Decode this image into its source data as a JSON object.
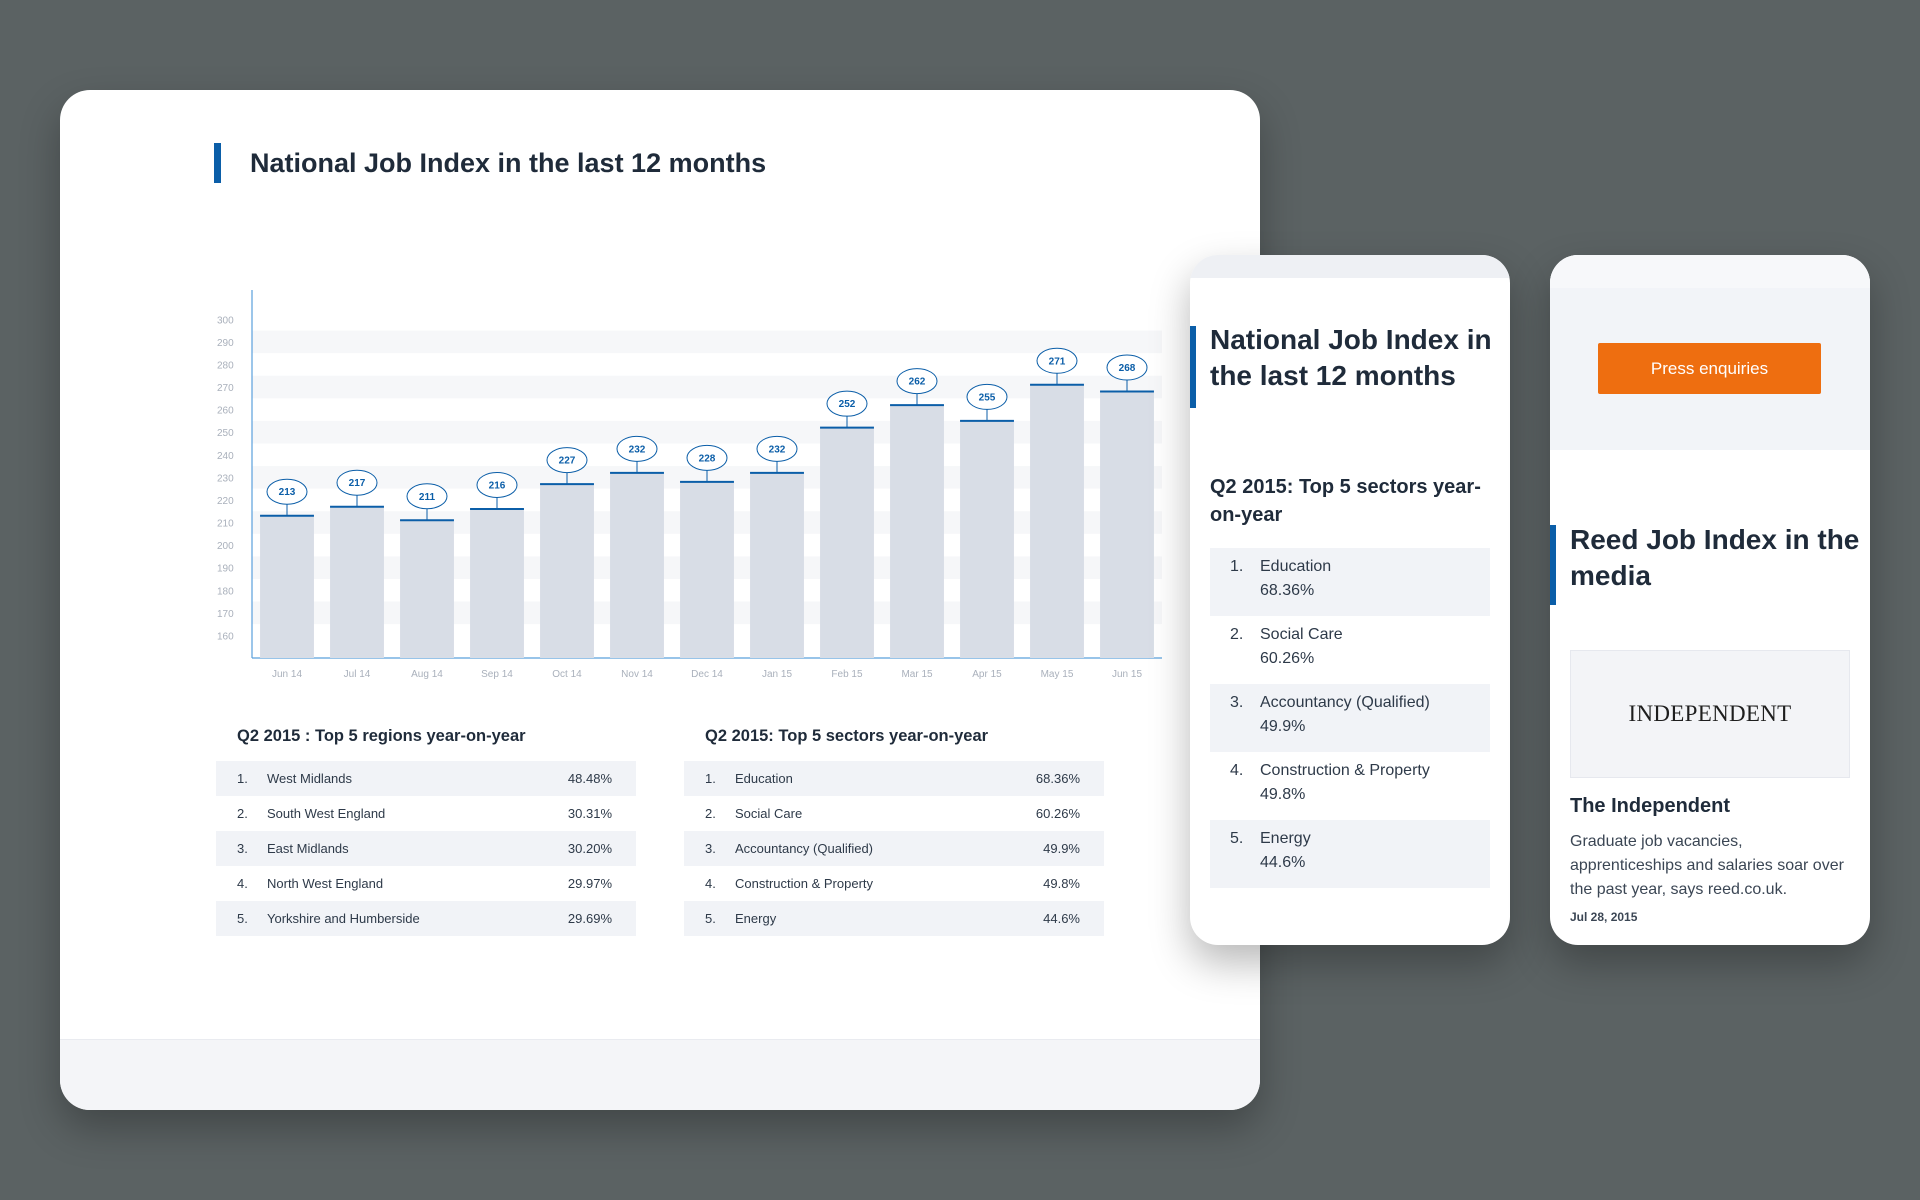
{
  "desktop": {
    "title": "National Job Index in the last 12 months",
    "regions_heading": "Q2 2015 : Top 5 regions year-on-year",
    "regions": [
      {
        "rank": "1.",
        "name": "West Midlands",
        "pct": "48.48%"
      },
      {
        "rank": "2.",
        "name": "South West England",
        "pct": "30.31%"
      },
      {
        "rank": "3.",
        "name": "East Midlands",
        "pct": "30.20%"
      },
      {
        "rank": "4.",
        "name": "North West England",
        "pct": "29.97%"
      },
      {
        "rank": "5.",
        "name": "Yorkshire and Humberside",
        "pct": "29.69%"
      }
    ],
    "sectors_heading": "Q2 2015: Top 5 sectors year-on-year",
    "sectors": [
      {
        "rank": "1.",
        "name": "Education",
        "pct": "68.36%"
      },
      {
        "rank": "2.",
        "name": "Social Care",
        "pct": "60.26%"
      },
      {
        "rank": "3.",
        "name": "Accountancy (Qualified)",
        "pct": "49.9%"
      },
      {
        "rank": "4.",
        "name": "Construction & Property",
        "pct": "49.8%"
      },
      {
        "rank": "5.",
        "name": "Energy",
        "pct": "44.6%"
      }
    ]
  },
  "chart_data": {
    "type": "bar",
    "categories": [
      "Jun 14",
      "Jul 14",
      "Aug 14",
      "Sep 14",
      "Oct 14",
      "Nov 14",
      "Dec 14",
      "Jan 15",
      "Feb 15",
      "Mar 15",
      "Apr 15",
      "May 15",
      "Jun 15"
    ],
    "values": [
      213,
      217,
      211,
      216,
      227,
      232,
      228,
      232,
      252,
      262,
      255,
      271,
      268
    ],
    "yticks": [
      160,
      170,
      180,
      190,
      200,
      210,
      220,
      230,
      240,
      250,
      260,
      270,
      280,
      290,
      300
    ],
    "ylim": [
      150,
      305
    ],
    "title": "",
    "xlabel": "",
    "ylabel": "",
    "grid": "horizontal bands",
    "colors": {
      "bar": "#d8dde6",
      "accent": "#0b5ea8",
      "axis": "#5aa0dc"
    }
  },
  "mobile_sectors": {
    "title": "National Job Index in the last 12 months",
    "subtitle": "Q2 2015: Top 5 sectors year-on-year",
    "items": [
      {
        "rank": "2.",
        "name": "Social Care",
        "pct": "60.26%"
      }
    ],
    "all_items": [
      {
        "rank": "1.",
        "name": "Education",
        "pct": "68.36%"
      },
      {
        "rank": "2.",
        "name": "Social Care",
        "pct": "60.26%"
      },
      {
        "rank": "3.",
        "name": "Accountancy (Qualified)",
        "pct": "49.9%"
      },
      {
        "rank": "4.",
        "name": "Construction & Property",
        "pct": "49.8%"
      },
      {
        "rank": "5.",
        "name": "Energy",
        "pct": "44.6%"
      }
    ]
  },
  "mobile_media": {
    "press_button": "Press enquiries",
    "title": "Reed Job Index in the media",
    "logo": "INDEPENDENT",
    "publication": "The Independent",
    "description": "Graduate job vacancies, apprenticeships and salaries soar over the past year, says reed.co.uk.",
    "date": "Jul 28, 2015"
  },
  "colors": {
    "accent": "#0b5ea8",
    "button": "#ee6e10",
    "background": "#5b6263"
  }
}
